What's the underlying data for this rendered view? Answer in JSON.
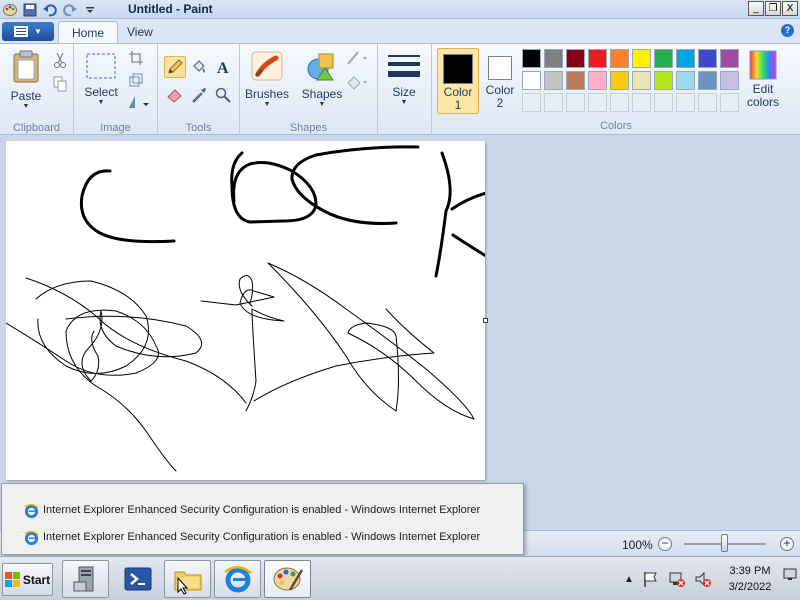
{
  "window": {
    "title": "Untitled - Paint",
    "controls": {
      "minimize": "_",
      "maximize": "❐",
      "close": "X"
    }
  },
  "tabs": [
    {
      "label": "Home",
      "active": true
    },
    {
      "label": "View",
      "active": false
    }
  ],
  "help": "?",
  "ribbon": {
    "clipboard": {
      "paste_label": "Paste",
      "group_label": "Clipboard"
    },
    "image": {
      "select_label": "Select",
      "group_label": "Image"
    },
    "tools": {
      "group_label": "Tools",
      "selected_tool": "pencil"
    },
    "brushes": {
      "label": "Brushes"
    },
    "shapes": {
      "label": "Shapes",
      "group_label": "Shapes"
    },
    "size": {
      "label": "Size"
    },
    "colors": {
      "color1_label": "Color 1",
      "color1_line1": "Color",
      "color1_line2": "1",
      "color1_value": "#000000",
      "color2_line1": "Color",
      "color2_line2": "2",
      "color2_value": "#ffffff",
      "edit_line1": "Edit",
      "edit_line2": "colors",
      "group_label": "Colors",
      "palette": [
        "#000000",
        "#7f7f7f",
        "#880015",
        "#ed1c24",
        "#ff7f27",
        "#fff200",
        "#22b14c",
        "#00a2e8",
        "#3f48cc",
        "#a349a4",
        "#ffffff",
        "#c3c3c3",
        "#b97a57",
        "#ffaec9",
        "#ffc90e",
        "#efe4b0",
        "#b5e61d",
        "#99d9ea",
        "#7092be",
        "#c8bfe7"
      ]
    }
  },
  "status": {
    "zoom": "100%",
    "zoom_out": "−",
    "zoom_in": "+",
    "zoom_level": 0.5
  },
  "popup": {
    "items": [
      "Internet Explorer Enhanced Security Configuration is enabled - Windows Internet Explorer",
      "Internet Explorer Enhanced Security Configuration is enabled - Windows Internet Explorer"
    ]
  },
  "taskbar": {
    "start": "Start",
    "time": "3:39 PM",
    "date": "3/2/2022"
  }
}
